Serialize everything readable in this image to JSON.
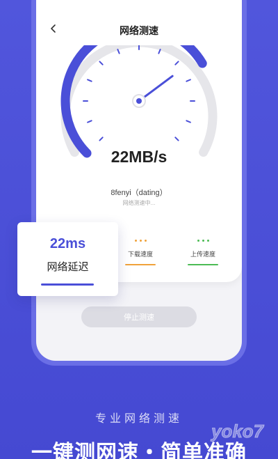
{
  "header": {
    "title": "网络测速"
  },
  "gauge": {
    "speed_text": "22MB/s",
    "progress": 0.72,
    "accent": "#4a4fd8",
    "track": "#e6e6ea"
  },
  "network": {
    "name": "8fenyi（dating）",
    "status": "网络测速中..."
  },
  "latency": {
    "value": "22ms",
    "label": "网络延迟"
  },
  "metrics": [
    {
      "label": "下载速度",
      "color": "#f0a23a"
    },
    {
      "label": "上传速度",
      "color": "#4cbb54"
    }
  ],
  "stop_button": {
    "label": "停止测速"
  },
  "promo": {
    "tagline": "专业网络测速",
    "headline": "一键测网速・简单准确",
    "watermark": "yoko7.com"
  }
}
